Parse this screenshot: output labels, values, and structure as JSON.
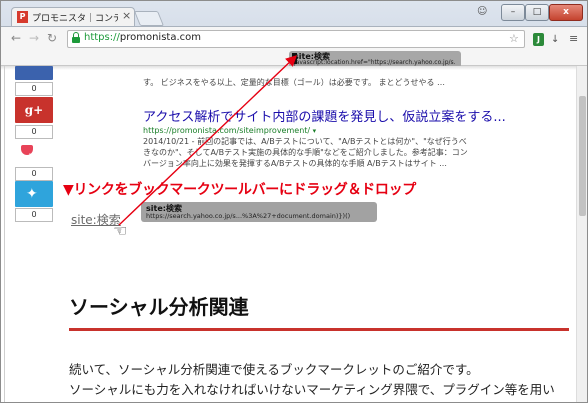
{
  "browser": {
    "tab_title": "プロモニスタ｜コンテン",
    "tab_favicon_letter": "P",
    "tab_close": "×",
    "url_scheme": "https://",
    "url_host": "promonista.com",
    "window_controls": {
      "minimize": "–",
      "maximize": "□",
      "close": "x"
    },
    "icons": [
      "back-icon",
      "forward-icon",
      "reload-icon",
      "lock-icon",
      "star-icon",
      "extension-icon",
      "menu-icon",
      "user-icon"
    ]
  },
  "bookmarks_bar": {
    "chip_title": "site:検索",
    "chip_url": "javascript:location.href=\"https://search.yahoo.co.jp/s...%3A%27+document.domain)})()"
  },
  "share_buttons": [
    {
      "name": "facebook",
      "count": "0"
    },
    {
      "name": "google-plus",
      "label": "g+",
      "count": "0"
    },
    {
      "name": "pocket",
      "count": "0"
    },
    {
      "name": "twitter",
      "count": "0"
    }
  ],
  "search_result": {
    "snippet_top": "す。 ビジネスをやる以上、定量的な目標（ゴール）は必要です。 まとどうせやる …",
    "title": "アクセス解析でサイト内部の課題を発見し、仮説立案をする...",
    "url": "https://promonista.com/siteimprovement/",
    "url_arrow": "▾",
    "snippet": "2014/10/21 - 前回の記事では、A/Bテストについて、\"A/Bテストとは何か\"、\"なぜ行うべきなのか\"、そしてA/Bテスト実施の具体的な手順\"などをご紹介しました。参考記事：コンバージョン率向上に効果を発揮するA/Bテストの具体的な手順 A/Bテストはサイト ..."
  },
  "instruction": "▼リンクをブックマークツールバーにドラッグ＆ドロップ",
  "sample_link": {
    "label": "site:検索",
    "chip_title": "site:検索",
    "chip_url": "https://search.yahoo.co.jp/s...%3A%27+document.domain)})()"
  },
  "article": {
    "heading": "ソーシャル分析関連",
    "paragraph_1": "続いて、ソーシャル分析関連で使えるブックマークレットのご紹介です。",
    "paragraph_2": "ソーシャルにも力を入れなければいけないマーケティング界隈で、プラグイン等を用い"
  },
  "colors": {
    "accent_red": "#e60012",
    "rule_red": "#c8322c",
    "link_blue": "#1a0dab",
    "url_green": "#1a7e28"
  }
}
